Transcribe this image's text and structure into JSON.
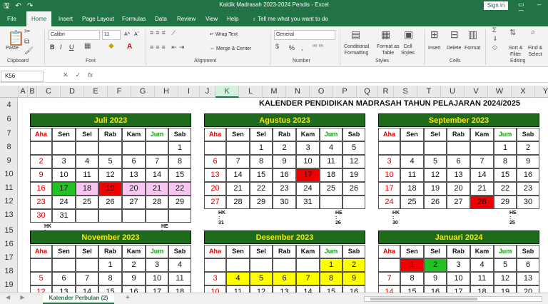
{
  "window": {
    "title": "Kaldik Madrasah 2023-2024 Pendis  -  Excel",
    "signin": "Sign in"
  },
  "tabs": [
    "File",
    "Home",
    "Insert",
    "Page Layout",
    "Formulas",
    "Data",
    "Review",
    "View",
    "Help"
  ],
  "tell_me": "Tell me what you want to do",
  "ribbon": {
    "clipboard": {
      "paste": "Paste",
      "group": "Clipboard"
    },
    "font": {
      "name": "Calibri",
      "size": "11",
      "group": "Font",
      "bold": "B",
      "italic": "I",
      "underline": "U",
      "grow": "A^",
      "shrink": "Aˇ",
      "color_a": "A"
    },
    "alignment": {
      "wrap": "Wrap Text",
      "merge": "Merge & Center",
      "group": "Alignment"
    },
    "number": {
      "format": "General",
      "group": "Number",
      "pct": "%",
      "comma": ","
    },
    "styles": {
      "cond": "Conditional",
      "cond2": "Formatting",
      "fmt_table": "Format as",
      "fmt_table2": "Table",
      "cell_styles": "Cell",
      "cell_styles2": "Styles",
      "group": "Styles"
    },
    "cells": {
      "insert": "Insert",
      "delete": "Delete",
      "format": "Format",
      "group": "Cells"
    },
    "editing": {
      "sort": "Sort &",
      "sort2": "Filter",
      "find": "Find &",
      "find2": "Select",
      "group": "Editing"
    }
  },
  "formula_bar": {
    "name_box": "K56",
    "fx": "fx",
    "cancel": "✕",
    "enter": "✓"
  },
  "columns": [
    "A",
    "B",
    "C",
    "D",
    "E",
    "F",
    "G",
    "H",
    "I",
    "J",
    "K",
    "L",
    "M",
    "N",
    "O",
    "P",
    "Q",
    "R",
    "S",
    "T",
    "U",
    "V",
    "W",
    "X",
    "Y"
  ],
  "selected_column": "K",
  "rows": [
    "4",
    "6",
    "7",
    "8",
    "9",
    "10",
    "11",
    "12",
    "13",
    "15",
    "16",
    "17",
    "18",
    "19",
    "20"
  ],
  "sheet_title": "KALENDER PENDIDIKAN MADRASAH TAHUN PELAJARAN 2024/2025",
  "day_headers": [
    "Aha",
    "Sen",
    "Sel",
    "Rab",
    "Kam",
    "Jum",
    "Sab"
  ],
  "calendars": [
    {
      "month": "Juli 2023",
      "weeks": [
        [
          "",
          "",
          "",
          "",
          "",
          "",
          "1"
        ],
        [
          "2",
          "3",
          "4",
          "5",
          "6",
          "7",
          "8"
        ],
        [
          "9",
          "10",
          "11",
          "12",
          "13",
          "14",
          "15"
        ],
        [
          "16",
          "17",
          "18",
          "19",
          "20",
          "21",
          "22"
        ],
        [
          "23",
          "24",
          "25",
          "26",
          "27",
          "28",
          "29"
        ],
        [
          "30",
          "31",
          "",
          "",
          "",
          "",
          ""
        ]
      ],
      "hk": "HK : 31",
      "he": "HE : 12",
      "fills": {
        "3-1": "green",
        "3-2": "pink",
        "3-3": "red",
        "3-4": "pink",
        "3-5": "pink",
        "3-6": "pink"
      }
    },
    {
      "month": "Agustus 2023",
      "weeks": [
        [
          "",
          "",
          "1",
          "2",
          "3",
          "4",
          "5"
        ],
        [
          "6",
          "7",
          "8",
          "9",
          "10",
          "11",
          "12"
        ],
        [
          "13",
          "14",
          "15",
          "16",
          "17",
          "18",
          "19"
        ],
        [
          "20",
          "21",
          "22",
          "23",
          "24",
          "25",
          "26"
        ],
        [
          "27",
          "28",
          "29",
          "30",
          "31",
          "",
          ""
        ]
      ],
      "hk": "HK : 31",
      "he": "HE : 26",
      "fills": {
        "2-4": "red"
      }
    },
    {
      "month": "September 2023",
      "weeks": [
        [
          "",
          "",
          "",
          "",
          "",
          "1",
          "2"
        ],
        [
          "3",
          "4",
          "5",
          "6",
          "7",
          "8",
          "9"
        ],
        [
          "10",
          "11",
          "12",
          "13",
          "14",
          "15",
          "16"
        ],
        [
          "17",
          "18",
          "19",
          "20",
          "21",
          "22",
          "23"
        ],
        [
          "24",
          "25",
          "26",
          "27",
          "28",
          "29",
          "30"
        ]
      ],
      "hk": "HK : 30",
      "he": "HE : 25",
      "fills": {
        "4-4": "red"
      }
    },
    {
      "month": "November 2023",
      "weeks": [
        [
          "",
          "",
          "",
          "1",
          "2",
          "3",
          "4"
        ],
        [
          "5",
          "6",
          "7",
          "8",
          "9",
          "10",
          "11"
        ],
        [
          "12",
          "13",
          "14",
          "15",
          "16",
          "17",
          "18"
        ]
      ],
      "hk": "",
      "he": "",
      "fills": {}
    },
    {
      "month": "Desember 2023",
      "weeks": [
        [
          "",
          "",
          "",
          "",
          "",
          "1",
          "2"
        ],
        [
          "3",
          "4",
          "5",
          "6",
          "7",
          "8",
          "9"
        ],
        [
          "10",
          "11",
          "12",
          "13",
          "14",
          "15",
          "16"
        ]
      ],
      "hk": "",
      "he": "",
      "fills": {
        "0-5": "yellow",
        "0-6": "yellow",
        "1-1": "yellow",
        "1-2": "yellow",
        "1-3": "yellow",
        "1-4": "yellow",
        "1-5": "yellow",
        "1-6": "yellow"
      }
    },
    {
      "month": "Januari 2024",
      "weeks": [
        [
          "",
          "1",
          "2",
          "3",
          "4",
          "5",
          "6"
        ],
        [
          "7",
          "8",
          "9",
          "10",
          "11",
          "12",
          "13"
        ],
        [
          "14",
          "15",
          "16",
          "17",
          "18",
          "19",
          "20"
        ]
      ],
      "hk": "",
      "he": "",
      "fills": {
        "0-1": "red",
        "0-2": "green"
      }
    }
  ],
  "sheet_tab": "Kalender Perbulan (2)",
  "add_sheet": "+",
  "colors": {
    "excel_green": "#217346",
    "title_green": "#1e6b1e",
    "title_yellow": "#ffe600",
    "holiday_red": "#f00000",
    "fill_green": "#21c221",
    "fill_pink": "#f9c6f3",
    "fill_yellow": "#ffff00"
  }
}
